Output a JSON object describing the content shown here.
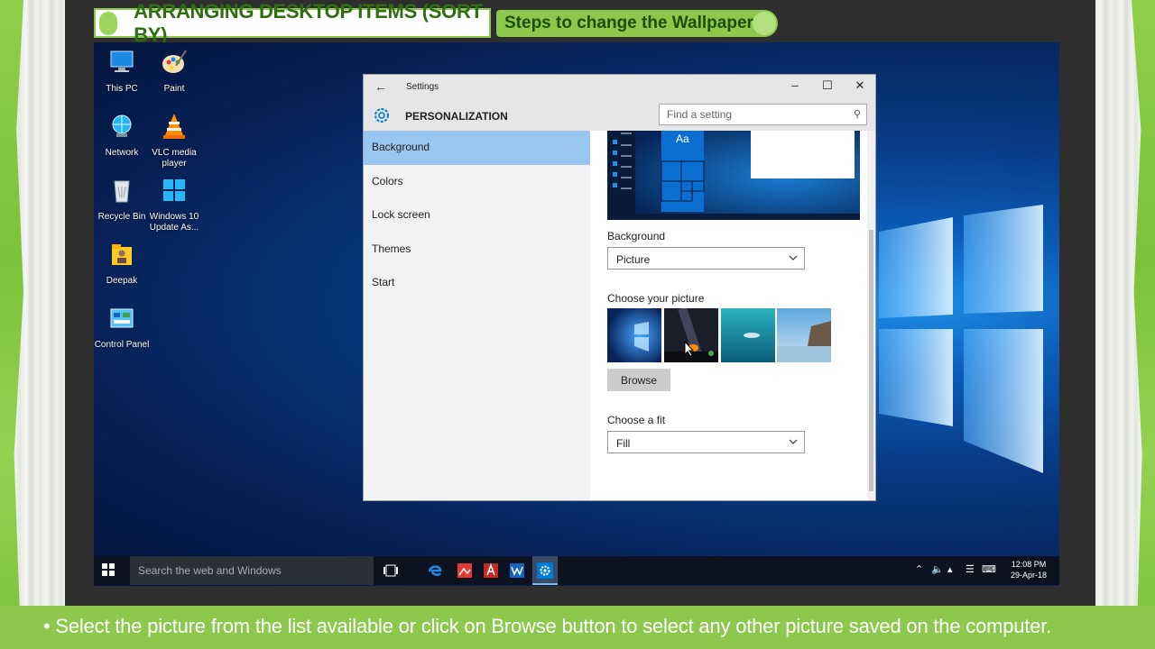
{
  "lesson": {
    "main_title": "ARRANGING DESKTOP ITEMS (SORT BY)",
    "sub_title": "Steps to change the Wallpaper",
    "caption": "• Select the picture from the list available or click on Browse button to select any other picture saved on the computer."
  },
  "desktop": {
    "icons": [
      {
        "label": "This PC",
        "icon": "computer-icon"
      },
      {
        "label": "Paint",
        "icon": "paint-palette-icon"
      },
      {
        "label": "Network",
        "icon": "network-globe-icon"
      },
      {
        "label": "VLC media player",
        "icon": "vlc-cone-icon"
      },
      {
        "label": "Recycle Bin",
        "icon": "recycle-bin-icon"
      },
      {
        "label": "Windows 10 Update As...",
        "icon": "windows-update-icon"
      },
      {
        "label": "Deepak",
        "icon": "user-folder-icon"
      },
      {
        "label": "Control Panel",
        "icon": "control-panel-icon"
      }
    ]
  },
  "window": {
    "title": "Settings",
    "section": "PERSONALIZATION",
    "search_placeholder": "Find a setting",
    "nav": [
      {
        "label": "Background",
        "active": true
      },
      {
        "label": "Colors",
        "active": false
      },
      {
        "label": "Lock screen",
        "active": false
      },
      {
        "label": "Themes",
        "active": false
      },
      {
        "label": "Start",
        "active": false
      }
    ],
    "preview_sample_text": "Aa",
    "background_label": "Background",
    "background_value": "Picture",
    "choose_picture_label": "Choose your picture",
    "browse_label": "Browse",
    "fit_label": "Choose a fit",
    "fit_value": "Fill"
  },
  "taskbar": {
    "search_placeholder": "Search the web and Windows",
    "pinned": [
      "task-view-icon",
      "edge-icon",
      "photo-app-icon",
      "pdf-reader-icon",
      "word-icon",
      "settings-icon"
    ],
    "time": "12:08 PM",
    "date": "29-Apr-18"
  },
  "colors": {
    "accent_green": "#8cc84b",
    "header_text": "#2e6e12",
    "nav_active": "#99c6ee",
    "windows_blue": "#0078d7"
  }
}
